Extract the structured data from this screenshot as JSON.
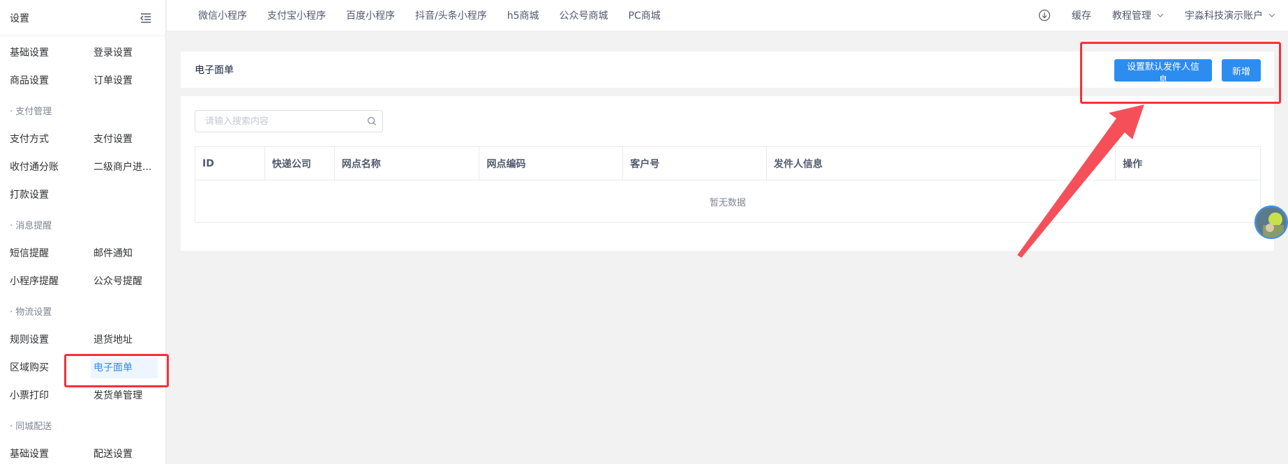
{
  "sidebar": {
    "title": "设置",
    "rows": [
      {
        "type": "items",
        "items": [
          "基础设置",
          "登录设置"
        ]
      },
      {
        "type": "items",
        "items": [
          "商品设置",
          "订单设置"
        ]
      },
      {
        "type": "group",
        "label": "· 支付管理"
      },
      {
        "type": "items",
        "items": [
          "支付方式",
          "支付设置"
        ]
      },
      {
        "type": "items",
        "items": [
          "收付通分账",
          "二级商户进..."
        ]
      },
      {
        "type": "items",
        "items": [
          "打款设置"
        ]
      },
      {
        "type": "group",
        "label": "· 消息提醒"
      },
      {
        "type": "items",
        "items": [
          "短信提醒",
          "邮件通知"
        ]
      },
      {
        "type": "items",
        "items": [
          "小程序提醒",
          "公众号提醒"
        ]
      },
      {
        "type": "group",
        "label": "· 物流设置"
      },
      {
        "type": "items",
        "items": [
          "规则设置",
          "退货地址"
        ]
      },
      {
        "type": "items",
        "items": [
          "区域购买",
          "电子面单"
        ],
        "active": 1
      },
      {
        "type": "items",
        "items": [
          "小票打印",
          "发货单管理"
        ]
      },
      {
        "type": "group",
        "label": "· 同城配送"
      },
      {
        "type": "items",
        "items": [
          "基础设置",
          "配送设置"
        ]
      }
    ]
  },
  "topnav": {
    "tabs": [
      "微信小程序",
      "支付宝小程序",
      "百度小程序",
      "抖音/头条小程序",
      "h5商城",
      "公众号商城",
      "PC商城"
    ],
    "cache_label": "缓存",
    "tutorial_label": "教程管理",
    "account_label": "宇淼科技演示账户"
  },
  "page": {
    "title": "电子面单",
    "btn_default_sender": "设置默认发件人信息",
    "btn_add": "新增"
  },
  "search": {
    "placeholder": "请输入搜索内容"
  },
  "table": {
    "columns": [
      "ID",
      "快递公司",
      "网点名称",
      "网点编码",
      "客户号",
      "发件人信息",
      "操作"
    ],
    "empty_text": "暂无数据"
  },
  "colors": {
    "primary": "#2d8cf0",
    "annotation": "#f0323c"
  }
}
